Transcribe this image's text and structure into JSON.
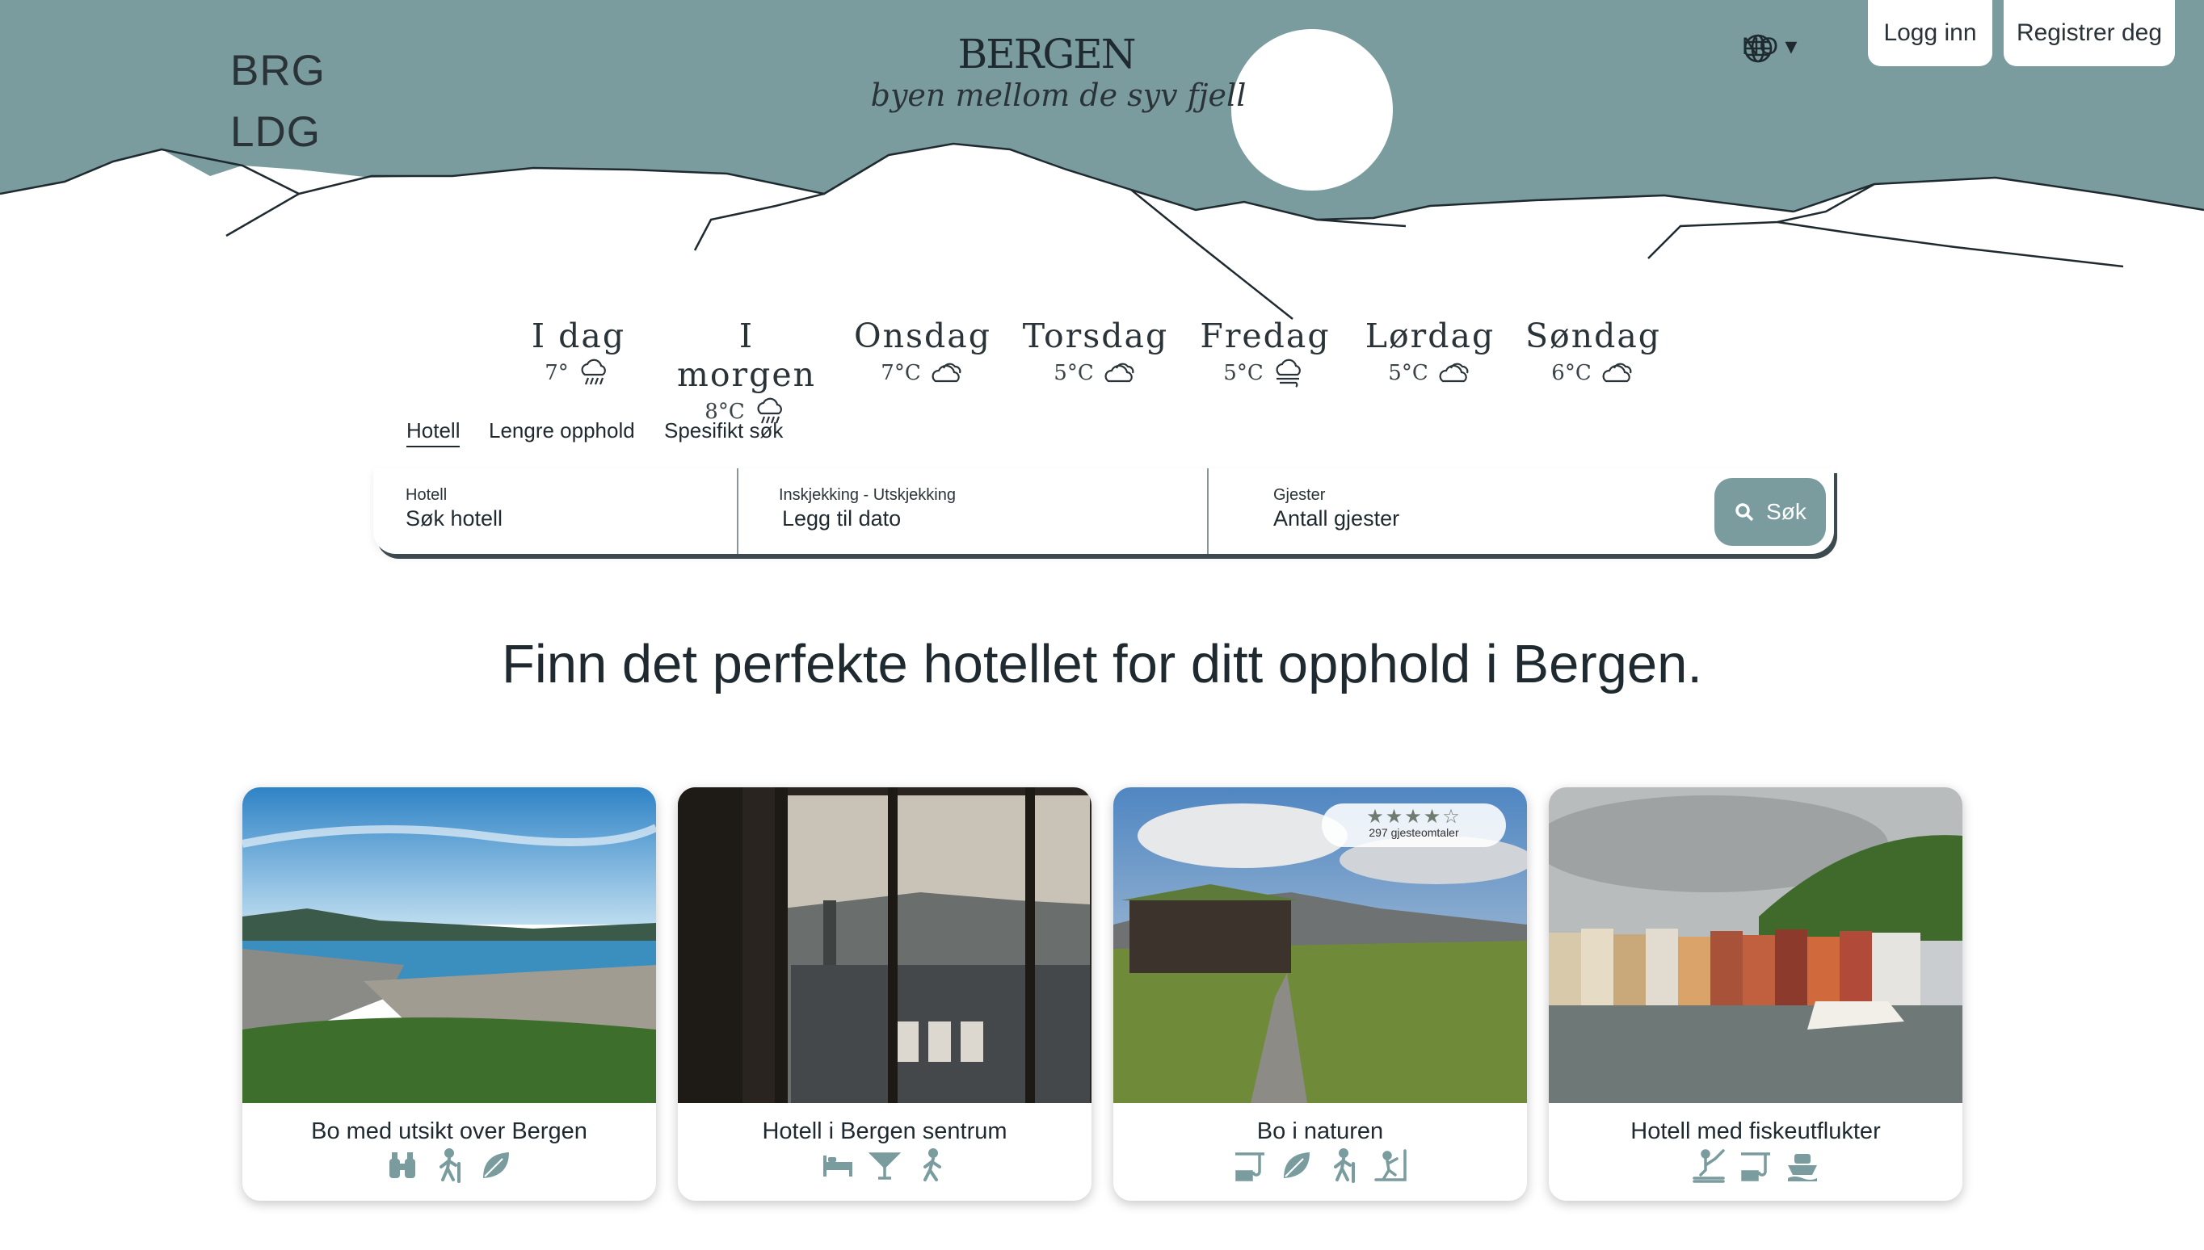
{
  "colors": {
    "sky": "#7a9c9e",
    "accent": "#7a9c9e",
    "text": "#1f2a30",
    "icon": "#7a9c9e"
  },
  "header": {
    "logo_line1": "BRG",
    "logo_line2": "LDG",
    "city_title": "BERGEN",
    "city_subtitle": "byen mellom de syv fjell",
    "language": "NO ▾",
    "login_label": "Logg inn",
    "register_label": "Registrer deg"
  },
  "weather": [
    {
      "day": "I dag",
      "temp": "7°",
      "icon": "rain-cloud-icon"
    },
    {
      "day": "I morgen",
      "temp": "8°C",
      "icon": "rain-cloud-icon"
    },
    {
      "day": "Onsdag",
      "temp": "7°C",
      "icon": "cloud-icon"
    },
    {
      "day": "Torsdag",
      "temp": "5°C",
      "icon": "cloud-icon"
    },
    {
      "day": "Fredag",
      "temp": "5°C",
      "icon": "wind-cloud-icon"
    },
    {
      "day": "Lørdag",
      "temp": "5°C",
      "icon": "cloud-icon"
    },
    {
      "day": "Søndag",
      "temp": "6°C",
      "icon": "cloud-icon"
    }
  ],
  "search": {
    "tabs": [
      "Hotell",
      "Lengre opphold",
      "Spesifikt søk"
    ],
    "active_tab": "Hotell",
    "hotel_label": "Hotell",
    "hotel_placeholder": "Søk hotell",
    "dates_label": "Inskjekking - Utskjekking",
    "dates_placeholder": "Legg til dato",
    "guests_label": "Gjester",
    "guests_placeholder": "Antall gjester",
    "button_label": "Søk"
  },
  "headline": "Finn det perfekte hotellet for ditt opphold i Bergen.",
  "cards": [
    {
      "title": "Bo med utsikt over Bergen",
      "icons": [
        "binoculars-icon",
        "hiking-icon",
        "leaf-icon"
      ]
    },
    {
      "title": "Hotell i Bergen sentrum",
      "icons": [
        "bed-icon",
        "cocktail-icon",
        "walking-icon"
      ]
    },
    {
      "title": "Bo i naturen",
      "icons": [
        "fishing-icon",
        "leaf-icon",
        "hiking-icon",
        "climbing-icon"
      ],
      "rating": {
        "stars": "★★★★☆",
        "value": 3.5,
        "count_text": "297 gjesteomtaler"
      }
    },
    {
      "title": "Hotell med fiskeutflukter",
      "icons": [
        "fishing-pier-icon",
        "fishing-icon",
        "boat-icon"
      ]
    }
  ]
}
